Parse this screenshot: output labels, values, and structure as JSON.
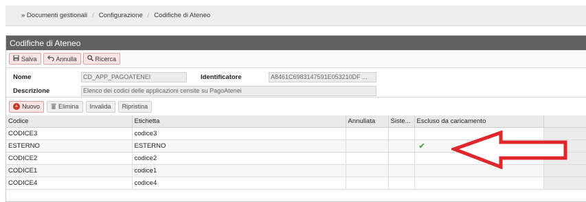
{
  "breadcrumb": {
    "items": [
      "» Documenti gestionali",
      "Configurazione",
      "Codifiche di Ateneo"
    ],
    "separator": "/"
  },
  "panel": {
    "title": "Codifiche di Ateneo"
  },
  "toolbar": {
    "save_label": "Salva",
    "cancel_label": "Annulla",
    "search_label": "Ricerca"
  },
  "form": {
    "nome_label": "Nome",
    "nome_value": "CD_APP_PAGOATENEI",
    "identificatore_label": "Identificatore",
    "identificatore_value": "A8461C6983147591E053210DF",
    "identificatore_more": "...",
    "descrizione_label": "Descrizione",
    "descrizione_value": "Elenco dei codici delle applicazioni censite su PagoAtenei"
  },
  "grid_toolbar": {
    "new_label": "Nuovo",
    "delete_label": "Elimina",
    "invalidate_label": "Invalida",
    "restore_label": "Ripristina"
  },
  "table": {
    "columns": [
      "Codice",
      "Etichetta",
      "Annullata",
      "Siste...",
      "Escluso da caricamento"
    ],
    "rows": [
      {
        "codice": "CODICE3",
        "etichetta": "codice3",
        "annullata": "",
        "sistema": "",
        "escluso": ""
      },
      {
        "codice": "ESTERNO",
        "etichetta": "ESTERNO",
        "annullata": "",
        "sistema": "",
        "escluso": "✔"
      },
      {
        "codice": "CODICE2",
        "etichetta": "codice2",
        "annullata": "",
        "sistema": "",
        "escluso": ""
      },
      {
        "codice": "CODICE1",
        "etichetta": "codice1",
        "annullata": "",
        "sistema": "",
        "escluso": ""
      },
      {
        "codice": "CODICE4",
        "etichetta": "codice4",
        "annullata": "",
        "sistema": "",
        "escluso": ""
      }
    ]
  },
  "colors": {
    "header_bg": "#616161",
    "button_bg": "#f9e3e3",
    "arrow": "#e0262b",
    "check": "#5aa84c"
  }
}
